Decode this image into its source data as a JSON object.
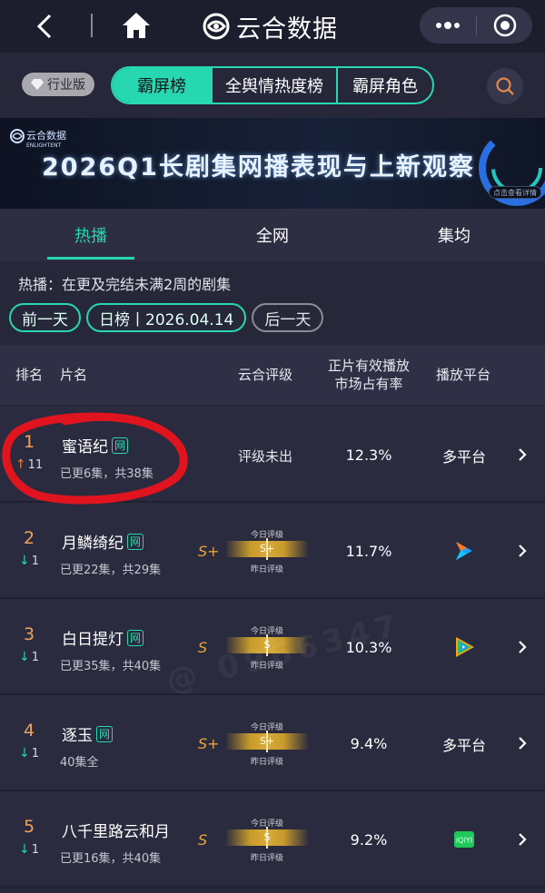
{
  "header": {
    "brand_name": "云合数据"
  },
  "nav": {
    "edition_label": "行业版",
    "segments": [
      "霸屏榜",
      "全舆情热度榜",
      "霸屏角色"
    ],
    "active_segment": 0
  },
  "banner": {
    "logo_text": "云合数据",
    "logo_sub": "ENLIGHTENT",
    "title": "2026Q1长剧集网播表现与上新观察",
    "pill_text": "点击查看详情"
  },
  "tabs": {
    "items": [
      "热播",
      "全网",
      "集均"
    ],
    "active": 0
  },
  "description": "热播：在更及完结未满2周的剧集",
  "date_controls": {
    "prev_label": "前一天",
    "date_label": "日榜丨2026.04.14",
    "next_label": "后一天"
  },
  "table": {
    "headers": {
      "rank": "排名",
      "title": "片名",
      "grade": "云合评级",
      "share_line1": "正片有效播放",
      "share_line2": "市场占有率",
      "platform": "播放平台"
    },
    "grade_today_label": "今日评级",
    "grade_yesterday_label": "昨日评级",
    "net_badge": "网",
    "rows": [
      {
        "rank": "1",
        "change": "11",
        "change_dir": "up",
        "title": "蜜语纪",
        "sub": "已更6集，共38集",
        "grade": "评级未出",
        "share": "12.3%",
        "platform": "多平台"
      },
      {
        "rank": "2",
        "change": "1",
        "change_dir": "down",
        "title": "月鳞绮纪",
        "sub": "已更22集，共29集",
        "grade": "S+",
        "share": "11.7%",
        "platform": "youku-icon"
      },
      {
        "rank": "3",
        "change": "1",
        "change_dir": "down",
        "title": "白日提灯",
        "sub": "已更35集，共40集",
        "grade": "S",
        "share": "10.3%",
        "platform": "tencent-video-icon"
      },
      {
        "rank": "4",
        "change": "1",
        "change_dir": "down",
        "title": "逐玉",
        "sub": "40集全",
        "grade": "S+",
        "share": "9.4%",
        "platform": "多平台"
      },
      {
        "rank": "5",
        "change": "1",
        "change_dir": "down",
        "title": "八千里路云和月",
        "sub": "已更16集，共40集",
        "grade": "S",
        "share": "9.2%",
        "platform": "iqiyi-icon"
      }
    ]
  },
  "watermark": "@ 0966347",
  "colors": {
    "accent": "#26d7b0",
    "rank": "#f0a15a",
    "grade_gold": "#e8a43b",
    "annotation_red": "#e0141e"
  }
}
